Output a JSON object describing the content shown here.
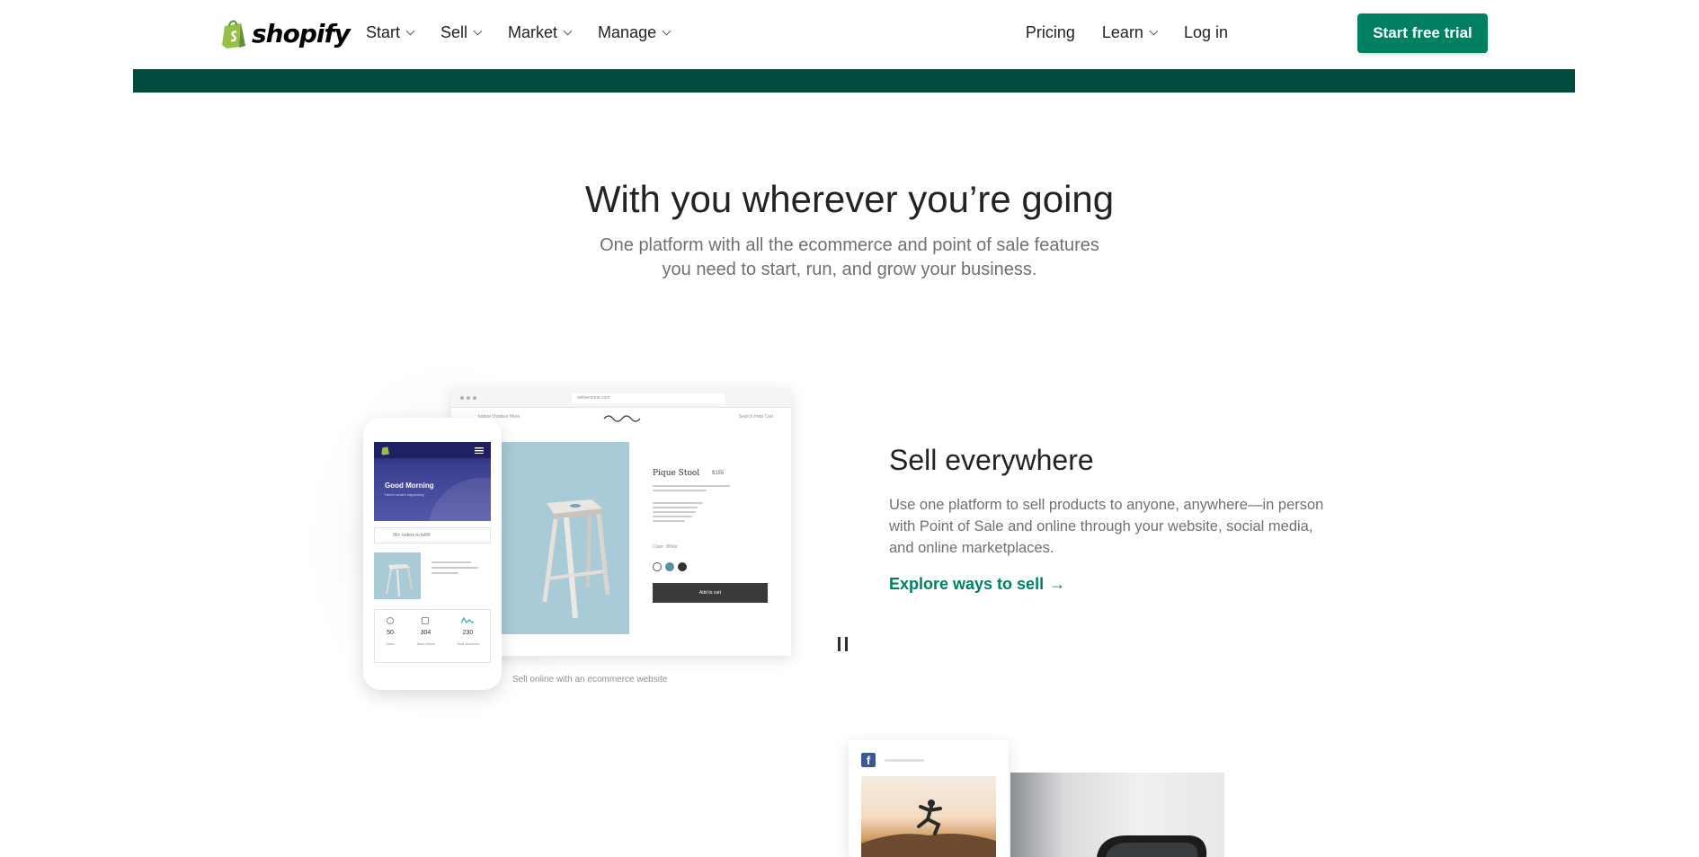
{
  "nav": {
    "logo_text": "shopify",
    "left_items": [
      {
        "label": "Start"
      },
      {
        "label": "Sell"
      },
      {
        "label": "Market"
      },
      {
        "label": "Manage"
      }
    ],
    "pricing": "Pricing",
    "learn": "Learn",
    "login": "Log in",
    "cta": "Start free trial"
  },
  "hero": {
    "title": "With you wherever you’re going",
    "subtitle_line1": "One platform with all the ecommerce and point of sale features",
    "subtitle_line2": "you need to start, run, and grow your business."
  },
  "illustration": {
    "url": "sellnerzone.com",
    "site_nav_left": "Indoor   Outdoor   More",
    "site_nav_right": "Search   Help   Cart",
    "product_title": "Pique Stool",
    "product_price": "$155",
    "color_label": "Color: White",
    "add_to_cart": "Add to cart",
    "caption": "Sell online with an ecommerce website",
    "phone": {
      "greeting": "Good Morning",
      "greeting_sub": "Here's what's happening",
      "orders": "90+ orders to fulfill",
      "stats": [
        {
          "value": "50",
          "label": "Sales"
        },
        {
          "value": "304",
          "label": "Total orders"
        },
        {
          "value": "230",
          "label": "Total sessions"
        }
      ]
    },
    "colors": {
      "swatch_white": "#ffffff",
      "swatch_blue": "#5b8fa3",
      "swatch_dark": "#333333"
    }
  },
  "feature": {
    "title": "Sell everywhere",
    "body": "Use one platform to sell products to anyone, anywhere—in person with Point of Sale and online through your website, social media, and online marketplaces.",
    "link": "Explore ways to sell",
    "link_arrow": "→"
  },
  "icons": {
    "logo": "shopify-bag-icon",
    "pause": "pause-icon",
    "facebook": "facebook-icon",
    "nav_chevron": "chevron-down-icon"
  },
  "theme": {
    "brand_green": "#008060",
    "band_green": "#004c3f"
  }
}
